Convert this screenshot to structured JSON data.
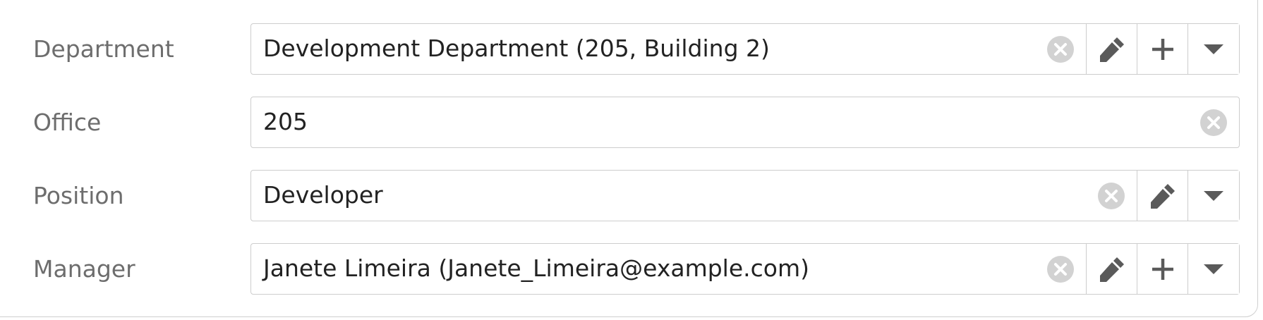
{
  "fields": {
    "department": {
      "label": "Department",
      "value": "Development Department (205, Building 2)",
      "icons": [
        "clear-icon",
        "pencil-icon",
        "plus-icon",
        "caret-down-icon"
      ]
    },
    "office": {
      "label": "Office",
      "value": "205",
      "icons": [
        "clear-icon"
      ]
    },
    "position": {
      "label": "Position",
      "value": "Developer",
      "icons": [
        "clear-icon",
        "pencil-icon",
        "caret-down-icon"
      ]
    },
    "manager": {
      "label": "Manager",
      "value": "Janete Limeira (Janete_Limeira@example.com)",
      "icons": [
        "clear-icon",
        "pencil-icon",
        "plus-icon",
        "caret-down-icon"
      ]
    }
  },
  "colors": {
    "label": "#6d6d6d",
    "value": "#222222",
    "icon": "#5a5a5a",
    "clear_icon": "#d2d2d2",
    "border": "#cdcdcd"
  }
}
